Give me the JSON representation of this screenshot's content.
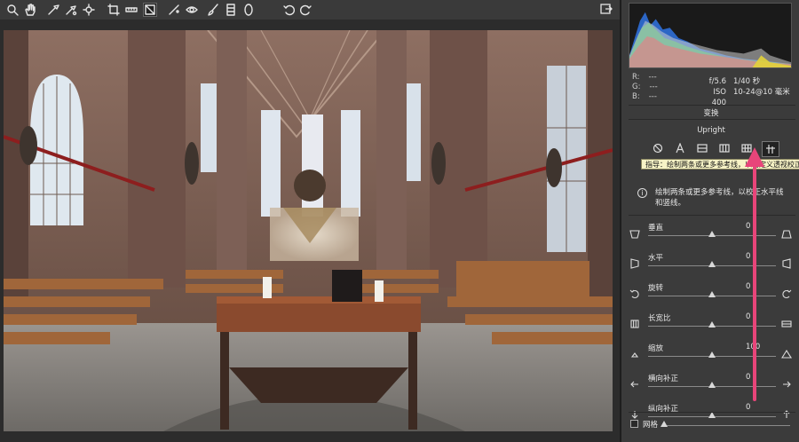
{
  "toolbar": {
    "tools": [
      {
        "icon": "zoom-icon"
      },
      {
        "icon": "hand-icon"
      },
      {
        "icon": "white-balance-icon"
      },
      {
        "icon": "color-sampler-icon"
      },
      {
        "icon": "target-adjustment-icon"
      },
      {
        "icon": "crop-icon"
      },
      {
        "icon": "straighten-icon"
      },
      {
        "icon": "transform-icon",
        "active": true
      },
      {
        "icon": "spot-removal-icon"
      },
      {
        "icon": "red-eye-icon"
      },
      {
        "icon": "adjustment-brush-icon"
      },
      {
        "icon": "graduated-filter-icon"
      },
      {
        "icon": "radial-filter-icon"
      },
      {
        "icon": "rotate-left-icon"
      },
      {
        "icon": "rotate-right-icon"
      }
    ],
    "right_icon": "open-preferences-icon"
  },
  "readout": {
    "r_label": "R:",
    "r_value": "---",
    "g_label": "G:",
    "g_value": "---",
    "b_label": "B:",
    "b_value": "---"
  },
  "exif": {
    "aperture": "f/5.6",
    "shutter": "1/40 秒",
    "iso": "ISO 400",
    "lens": "10-24@10 毫米"
  },
  "transform": {
    "section_title": "变换",
    "upright_title": "Upright",
    "upright_modes": [
      {
        "icon": "off-icon"
      },
      {
        "icon": "auto-icon"
      },
      {
        "icon": "level-icon"
      },
      {
        "icon": "vertical-icon"
      },
      {
        "icon": "full-icon"
      },
      {
        "icon": "guided-icon",
        "active": true
      }
    ],
    "tooltip": "指导：绘制两条或更多参考线，以自定义透视校正",
    "info_text": "绘制两条或更多参考线，以校正水平线和竖线。"
  },
  "sliders": [
    {
      "label": "垂直",
      "value": "0",
      "level": 0.5,
      "icon_left": "vertical-left-icon",
      "icon_right": "vertical-right-icon"
    },
    {
      "label": "水平",
      "value": "0",
      "level": 0.5,
      "icon_left": "horizontal-left-icon",
      "icon_right": "horizontal-right-icon"
    },
    {
      "label": "旋转",
      "value": "0",
      "level": 0.5,
      "icon_left": "rotate-ccw-icon",
      "icon_right": "rotate-cw-icon"
    },
    {
      "label": "长宽比",
      "value": "0",
      "level": 0.5,
      "icon_left": "aspect-narrow-icon",
      "icon_right": "aspect-wide-icon"
    },
    {
      "label": "缩放",
      "value": "100",
      "level": 0.5,
      "icon_left": "scale-small-icon",
      "icon_right": "scale-large-icon"
    },
    {
      "label": "横向补正",
      "value": "0",
      "level": 0.5,
      "icon_left": "arrow-left-icon",
      "icon_right": "arrow-right-icon"
    },
    {
      "label": "纵向补正",
      "value": "0",
      "level": 0.5,
      "icon_left": "arrow-down-icon",
      "icon_right": "arrow-up-icon"
    }
  ],
  "grid": {
    "label": "网格",
    "checked": false
  },
  "colors": {
    "accent": "#e8457a",
    "tooltip_bg": "#f7f3c6"
  }
}
